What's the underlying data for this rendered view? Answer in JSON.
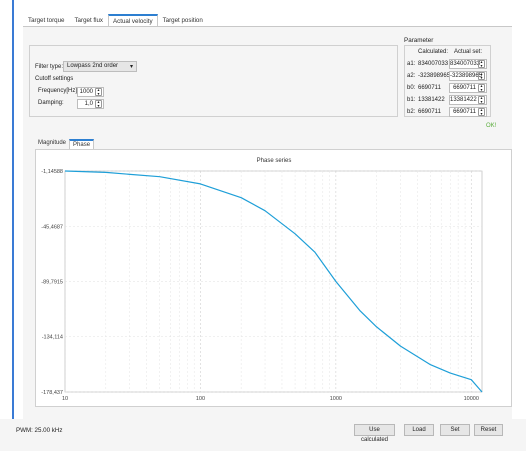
{
  "tabs": [
    "Target torque",
    "Target flux",
    "Actual velocity",
    "Target position"
  ],
  "active_tab_index": 2,
  "filter": {
    "type_label": "Filter type:",
    "type_value": "Lowpass 2nd order",
    "cutoff_label": "Cutoff settings",
    "frequency_label": "Frequency[Hz]:",
    "frequency_value": "1000",
    "damping_label": "Damping:",
    "damping_value": "1,0"
  },
  "parameter": {
    "title": "Parameter",
    "calculated_header": "Calculated:",
    "actual_header": "Actual set:",
    "rows": [
      {
        "name": "a1:",
        "calculated": "834007033",
        "actual": "834007033"
      },
      {
        "name": "a2:",
        "calculated": "-323898965",
        "actual": "-323898965"
      },
      {
        "name": "b0:",
        "calculated": "6690711",
        "actual": "6690711"
      },
      {
        "name": "b1:",
        "calculated": "13381422",
        "actual": "13381422"
      },
      {
        "name": "b2:",
        "calculated": "6690711",
        "actual": "6690711"
      }
    ],
    "status": "OK!"
  },
  "plot_tabs": [
    "Magnitude",
    "Phase"
  ],
  "active_plot_tab_index": 1,
  "chart_data": {
    "type": "line",
    "title": "Phase series",
    "x_scale": "log",
    "xlim": [
      10,
      12000
    ],
    "ylim": [
      -178.437,
      -1.14588
    ],
    "x_ticks": [
      10,
      100,
      1000,
      10000
    ],
    "x_tick_labels": [
      "10",
      "100",
      "1000",
      "10000"
    ],
    "y_ticks": [
      -1.14588,
      -45.4687,
      -89.7915,
      -134.114,
      -178.437
    ],
    "y_tick_labels": [
      "-1,14588",
      "-45,4687",
      "-89,7915",
      "-134,114",
      "-178,437"
    ],
    "grid": true,
    "series": [
      {
        "color": "#1e9fd8",
        "x": [
          10,
          20,
          50,
          100,
          200,
          300,
          500,
          700,
          1000,
          1500,
          2000,
          3000,
          5000,
          7000,
          10000,
          12000
        ],
        "y": [
          -1.15,
          -2.3,
          -5.7,
          -11.5,
          -22.6,
          -33.0,
          -51.5,
          -66.3,
          -89.8,
          -113.0,
          -126.2,
          -141.6,
          -156.5,
          -163.3,
          -168.6,
          -178.4
        ]
      }
    ]
  },
  "footer": {
    "pwm": "PWM: 25.00 kHz",
    "use_calculated": "Use calculated",
    "load": "Load",
    "set": "Set",
    "reset": "Reset"
  },
  "colors": {
    "accent": "#2d7fd1",
    "curve": "#1e9fd8",
    "ok": "#5aad3c"
  }
}
